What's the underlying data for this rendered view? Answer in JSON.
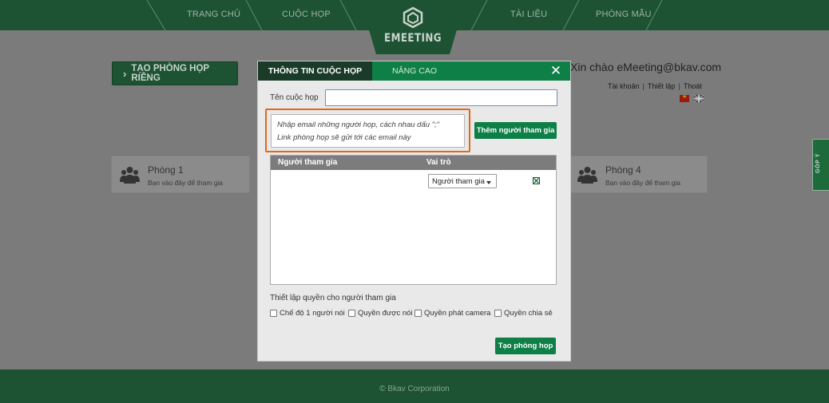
{
  "nav": {
    "home": "TRANG CHỦ",
    "meetings": "CUỘC HỌP",
    "docs": "TÀI LIỆU",
    "sample_rooms": "PHÒNG MẪU",
    "logo": "EMEETING"
  },
  "page": {
    "create_private_button": "TẠO PHÒNG HỌP RIÊNG",
    "greeting": "Xin chào eMeeting@bkav.com",
    "links": [
      "Tài khoản",
      "Thiết lập",
      "Thoát"
    ],
    "rooms": [
      {
        "title": "Phòng 1",
        "subtitle": "Bạn vào đây để tham gia"
      },
      {
        "title": "Phòng 4",
        "subtitle": "Bạn vào đây để tham gia"
      }
    ],
    "feedback": "GÓP Ý",
    "footer": "© Bkav Corporation"
  },
  "modal": {
    "tabs": [
      "THÔNG TIN CUỘC HỌP",
      "NÂNG CAO"
    ],
    "meeting_name_label": "Tên cuộc họp",
    "meeting_name_value": "",
    "email_hint_line1": "Nhập email những người họp, cách nhau dấu \";\"",
    "email_hint_line2": "Link phòng họp sẽ gửi tới các email này",
    "add_participant_button": "Thêm người tham gia",
    "table": {
      "headers": [
        "Người tham gia",
        "Vai trò"
      ],
      "rows": [
        {
          "participant": "",
          "role": "Người tham gia"
        }
      ]
    },
    "permissions_title": "Thiết lập quyền cho người tham gia",
    "permissions": [
      {
        "label": "Chế độ 1 người nói",
        "checked": false
      },
      {
        "label": "Quyền được nói",
        "checked": false
      },
      {
        "label": "Quyền phát camera",
        "checked": false
      },
      {
        "label": "Quyền chia sẻ",
        "checked": false
      }
    ],
    "create_button": "Tạo phòng họp"
  },
  "colors": {
    "brand_dark": "#1d5333",
    "brand_green": "#0d7f47",
    "highlight_orange": "#e1681b"
  }
}
